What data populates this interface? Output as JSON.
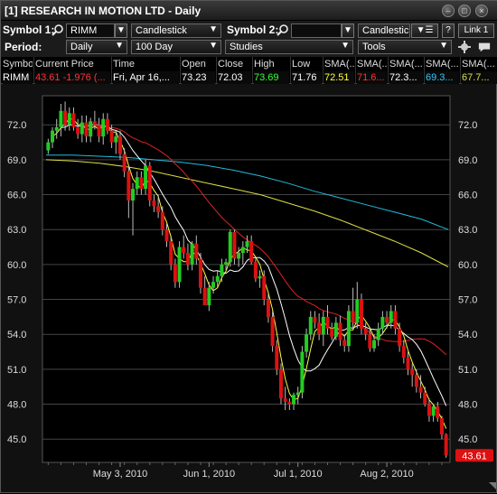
{
  "window": {
    "title": "[1] RESEARCH IN MOTION LTD - Daily"
  },
  "toolbar": {
    "symbol1_label": "Symbol 1:",
    "symbol1_value": "RIMM",
    "chart_type1": "Candlestick",
    "symbol2_label": "Symbol 2:",
    "symbol2_value": "",
    "chart_type2": "Candlestick",
    "period_label": "Period:",
    "period_value": "Daily",
    "range_value": "100 Day",
    "studies_value": "Studies",
    "tools_value": "Tools",
    "link_label": "Link 1",
    "help_label": "?"
  },
  "quote": {
    "headers": [
      "Symbol",
      "Current Price",
      "Time",
      "Open",
      "Close",
      "High",
      "Low",
      "SMA(...",
      "SMA(...",
      "SMA(...",
      "SMA(...",
      "SMA(..."
    ],
    "values": [
      "RIMM",
      "43.61  -1.976 (...",
      "Fri, Apr 16,...",
      "73.23",
      "72.03",
      "73.69",
      "71.76",
      "72.51",
      "71.6...",
      "72.3...",
      "69.3...",
      "67.7..."
    ],
    "value_colors": [
      "#ffffff",
      "#ff3333",
      "#ffffff",
      "#ffffff",
      "#ffffff",
      "#33ff33",
      "#ffffff",
      "#ffff33",
      "#ff3333",
      "#ffffff",
      "#33ccff",
      "#dddd55"
    ]
  },
  "chart_data": {
    "type": "candlestick",
    "ylim": [
      43.0,
      74.5
    ],
    "yticks": [
      "72.0",
      "69.0",
      "66.0",
      "63.0",
      "60.0",
      "57.0",
      "54.0",
      "51.0",
      "48.0",
      "45.0"
    ],
    "xticks": [
      "May 3, 2010",
      "Jun 1, 2010",
      "Jul 1, 2010",
      "Aug 2, 2010"
    ],
    "last_price_label": "43.61",
    "colors": {
      "up": "#22cc22",
      "down": "#dd1111",
      "sma_short": "#ffff44",
      "sma_mid": "#ffffff",
      "sma_50": "#dd2222",
      "sma_100": "#dddd44",
      "sma_200": "#22bbdd"
    },
    "candles": [
      [
        69.8,
        70.8,
        69.5,
        70.5
      ],
      [
        70.5,
        71.8,
        70.0,
        71.5
      ],
      [
        71.5,
        72.5,
        70.8,
        71.8
      ],
      [
        71.8,
        73.8,
        71.0,
        73.2
      ],
      [
        73.2,
        74.0,
        71.5,
        72.0
      ],
      [
        72.0,
        73.5,
        71.5,
        73.0
      ],
      [
        73.0,
        73.5,
        71.5,
        71.8
      ],
      [
        71.8,
        72.5,
        70.8,
        71.2
      ],
      [
        71.2,
        72.8,
        70.5,
        72.2
      ],
      [
        72.2,
        72.8,
        70.5,
        71.0
      ],
      [
        71.0,
        72.6,
        70.5,
        72.3
      ],
      [
        72.3,
        73.2,
        71.6,
        72.0
      ],
      [
        72.0,
        72.6,
        70.5,
        71.0
      ],
      [
        71.0,
        73.0,
        70.3,
        72.5
      ],
      [
        72.5,
        73.0,
        71.2,
        71.5
      ],
      [
        71.5,
        72.0,
        70.0,
        70.5
      ],
      [
        70.5,
        71.5,
        69.5,
        71.0
      ],
      [
        71.0,
        71.5,
        69.0,
        69.5
      ],
      [
        69.5,
        70.0,
        67.5,
        68.0
      ],
      [
        68.0,
        68.5,
        64.0,
        65.5
      ],
      [
        65.5,
        67.0,
        62.5,
        66.5
      ],
      [
        66.5,
        68.0,
        66.0,
        67.5
      ],
      [
        67.5,
        68.0,
        66.0,
        66.5
      ],
      [
        66.5,
        69.0,
        66.0,
        68.5
      ],
      [
        68.5,
        68.8,
        65.0,
        65.5
      ],
      [
        65.5,
        66.0,
        64.5,
        65.0
      ],
      [
        65.0,
        66.0,
        64.0,
        64.5
      ],
      [
        64.5,
        65.0,
        62.5,
        63.0
      ],
      [
        63.0,
        63.5,
        61.5,
        62.0
      ],
      [
        62.0,
        62.5,
        59.5,
        60.0
      ],
      [
        60.0,
        60.5,
        58.0,
        58.5
      ],
      [
        58.5,
        62.0,
        58.0,
        61.5
      ],
      [
        61.5,
        62.5,
        60.5,
        61.0
      ],
      [
        61.0,
        61.8,
        59.5,
        60.0
      ],
      [
        60.0,
        62.0,
        59.5,
        61.8
      ],
      [
        61.8,
        62.5,
        60.0,
        60.5
      ],
      [
        60.5,
        61.0,
        57.5,
        58.0
      ],
      [
        58.0,
        59.0,
        56.5,
        56.5
      ],
      [
        56.5,
        58.5,
        56.0,
        58.0
      ],
      [
        58.0,
        59.0,
        57.5,
        58.5
      ],
      [
        58.5,
        59.5,
        58.0,
        59.0
      ],
      [
        59.0,
        60.5,
        58.5,
        60.0
      ],
      [
        60.0,
        60.5,
        59.5,
        60.2
      ],
      [
        60.2,
        63.0,
        59.8,
        62.8
      ],
      [
        62.8,
        63.0,
        60.0,
        60.5
      ],
      [
        60.5,
        61.5,
        59.8,
        61.0
      ],
      [
        61.0,
        62.0,
        60.0,
        61.5
      ],
      [
        61.5,
        62.5,
        61.0,
        62.0
      ],
      [
        62.0,
        62.5,
        60.0,
        60.2
      ],
      [
        60.2,
        60.5,
        58.5,
        58.8
      ],
      [
        58.8,
        59.5,
        58.0,
        59.0
      ],
      [
        59.0,
        59.5,
        56.5,
        57.0
      ],
      [
        57.0,
        57.5,
        55.0,
        55.5
      ],
      [
        55.5,
        56.0,
        52.5,
        53.0
      ],
      [
        53.0,
        53.5,
        50.5,
        51.0
      ],
      [
        51.0,
        51.5,
        48.0,
        48.5
      ],
      [
        48.5,
        49.5,
        47.5,
        48.2
      ],
      [
        48.2,
        48.5,
        47.5,
        48.0
      ],
      [
        48.0,
        49.0,
        47.5,
        48.8
      ],
      [
        48.8,
        49.5,
        48.0,
        49.0
      ],
      [
        49.0,
        53.0,
        48.5,
        52.5
      ],
      [
        52.5,
        54.5,
        52.0,
        54.0
      ],
      [
        54.0,
        56.0,
        53.5,
        55.5
      ],
      [
        55.5,
        56.0,
        54.5,
        55.0
      ],
      [
        55.0,
        55.8,
        53.5,
        54.0
      ],
      [
        54.0,
        56.0,
        53.0,
        55.5
      ],
      [
        55.5,
        56.5,
        54.0,
        54.5
      ],
      [
        54.5,
        55.0,
        53.5,
        53.8
      ],
      [
        53.8,
        55.5,
        53.5,
        55.0
      ],
      [
        55.0,
        55.6,
        53.0,
        53.5
      ],
      [
        53.5,
        54.0,
        52.5,
        53.0
      ],
      [
        53.0,
        56.5,
        52.5,
        56.0
      ],
      [
        56.0,
        58.0,
        54.5,
        55.0
      ],
      [
        55.0,
        58.5,
        54.5,
        57.0
      ],
      [
        57.0,
        57.5,
        54.0,
        54.5
      ],
      [
        54.5,
        55.0,
        53.5,
        54.0
      ],
      [
        54.0,
        54.5,
        52.5,
        52.8
      ],
      [
        52.8,
        54.0,
        52.5,
        53.5
      ],
      [
        53.5,
        55.0,
        53.0,
        54.5
      ],
      [
        54.5,
        56.0,
        54.0,
        55.5
      ],
      [
        55.5,
        56.0,
        54.5,
        55.0
      ],
      [
        55.0,
        56.5,
        54.5,
        56.0
      ],
      [
        56.0,
        56.5,
        54.0,
        54.5
      ],
      [
        54.5,
        55.0,
        52.5,
        53.0
      ],
      [
        53.0,
        53.5,
        51.5,
        52.0
      ],
      [
        52.0,
        52.5,
        50.5,
        51.0
      ],
      [
        51.0,
        51.5,
        49.5,
        50.5
      ],
      [
        50.5,
        51.0,
        49.0,
        49.5
      ],
      [
        49.5,
        50.5,
        48.5,
        49.0
      ],
      [
        49.0,
        49.5,
        47.8,
        48.0
      ],
      [
        48.0,
        48.5,
        46.5,
        47.0
      ],
      [
        47.0,
        48.0,
        46.5,
        47.8
      ],
      [
        47.8,
        48.2,
        46.5,
        46.8
      ],
      [
        46.8,
        47.0,
        45.0,
        45.4
      ],
      [
        45.4,
        45.5,
        43.4,
        43.6
      ]
    ],
    "sma_100_line": [
      69.0,
      68.9,
      68.7,
      68.4,
      68.0,
      67.5,
      67.0,
      66.5,
      66.0,
      65.3,
      64.6,
      63.8,
      62.9,
      62.0,
      61.0,
      59.8
    ],
    "sma_200_line": [
      69.4,
      69.4,
      69.3,
      69.2,
      69.0,
      68.8,
      68.5,
      68.1,
      67.6,
      67.0,
      66.3,
      65.7,
      65.1,
      64.5,
      63.9,
      63.0
    ]
  }
}
